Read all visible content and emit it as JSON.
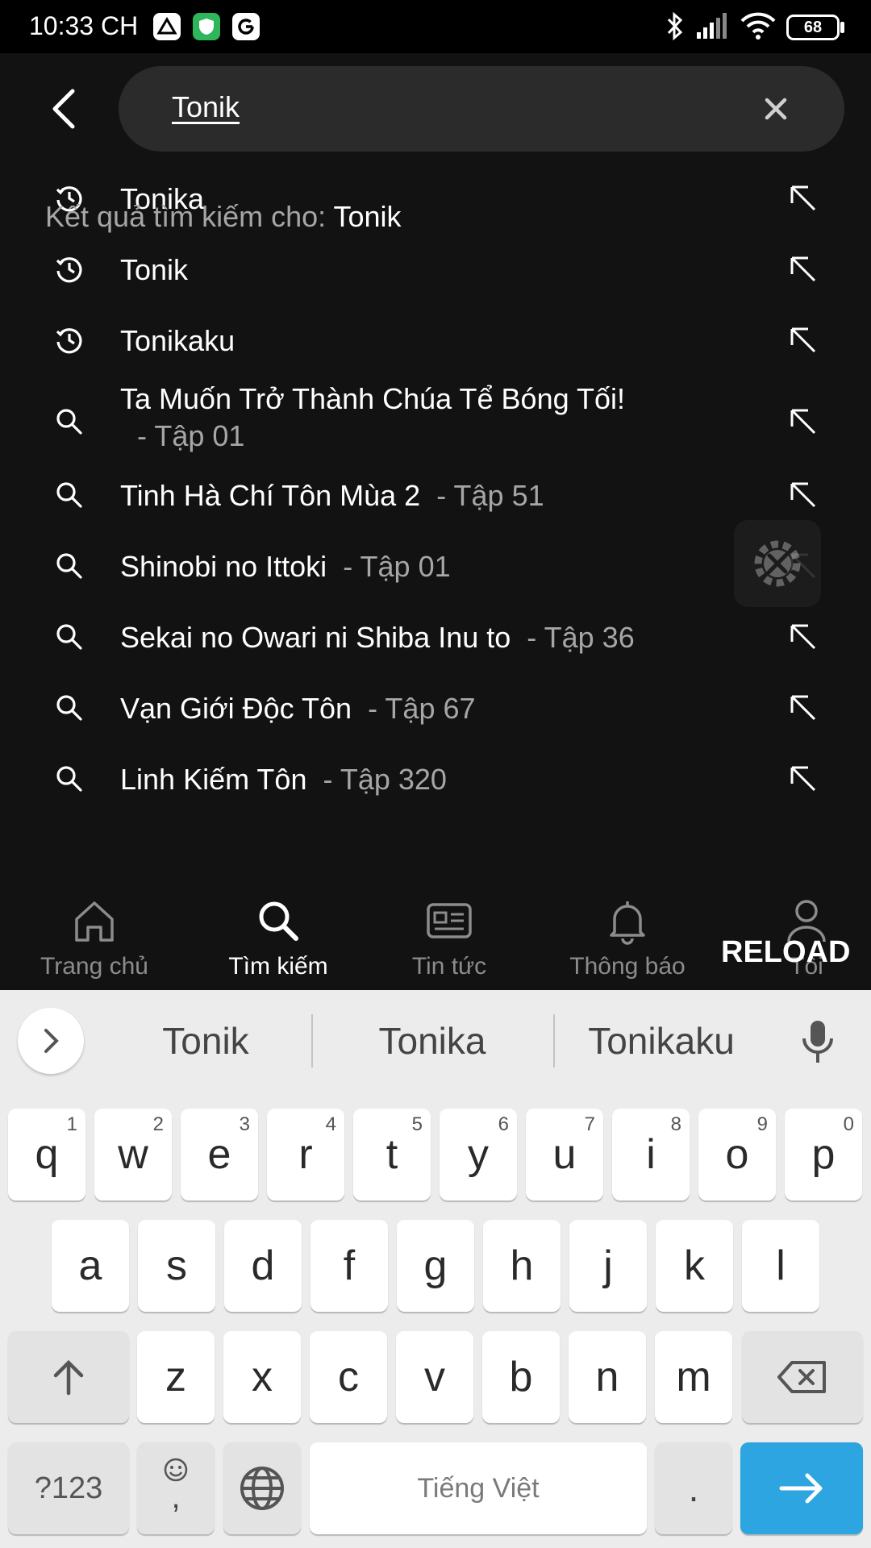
{
  "status_bar": {
    "time": "10:33 CH",
    "battery": "68"
  },
  "search": {
    "query": "Tonik"
  },
  "results_label": {
    "prefix": "Kết quả tìm kiếm cho: ",
    "query": "Tonik"
  },
  "suggestions": [
    {
      "type": "history",
      "title": "Tonika",
      "episode": ""
    },
    {
      "type": "history",
      "title": "Tonik",
      "episode": ""
    },
    {
      "type": "history",
      "title": "Tonikaku",
      "episode": ""
    },
    {
      "type": "search",
      "title": "Ta Muốn Trở Thành Chúa Tể Bóng Tối!",
      "episode": "- Tập 01"
    },
    {
      "type": "search",
      "title": "Tinh Hà Chí Tôn Mùa 2",
      "episode": "- Tập 51"
    },
    {
      "type": "search",
      "title": "Shinobi no Ittoki",
      "episode": "- Tập 01"
    },
    {
      "type": "search",
      "title": "Sekai no Owari ni Shiba Inu to",
      "episode": "- Tập 36"
    },
    {
      "type": "search",
      "title": "Vạn Giới Độc Tôn",
      "episode": "- Tập 67"
    },
    {
      "type": "search",
      "title": "Linh Kiếm Tôn",
      "episode": "- Tập 320"
    }
  ],
  "bottom_nav": {
    "items": [
      {
        "label": "Trang chủ",
        "icon": "home-icon"
      },
      {
        "label": "Tìm kiếm",
        "icon": "search-icon",
        "active": true
      },
      {
        "label": "Tin tức",
        "icon": "news-icon"
      },
      {
        "label": "Thông báo",
        "icon": "bell-icon"
      },
      {
        "label": "Tôi",
        "icon": "profile-icon"
      }
    ],
    "reload_label": "RELOAD"
  },
  "keyboard": {
    "suggestions": [
      "Tonik",
      "Tonika",
      "Tonikaku"
    ],
    "row1": [
      {
        "k": "q",
        "h": "1"
      },
      {
        "k": "w",
        "h": "2"
      },
      {
        "k": "e",
        "h": "3"
      },
      {
        "k": "r",
        "h": "4"
      },
      {
        "k": "t",
        "h": "5"
      },
      {
        "k": "y",
        "h": "6"
      },
      {
        "k": "u",
        "h": "7"
      },
      {
        "k": "i",
        "h": "8"
      },
      {
        "k": "o",
        "h": "9"
      },
      {
        "k": "p",
        "h": "0"
      }
    ],
    "row2": [
      "a",
      "s",
      "d",
      "f",
      "g",
      "h",
      "j",
      "k",
      "l"
    ],
    "row3": [
      "z",
      "x",
      "c",
      "v",
      "b",
      "n",
      "m"
    ],
    "symbols_label": "?123",
    "comma_label": ",",
    "space_label": "Tiếng Việt",
    "period_label": "."
  },
  "colors": {
    "background": "#121212",
    "enter_key": "#2ca5e0",
    "muted_text": "#a6a6a6"
  }
}
